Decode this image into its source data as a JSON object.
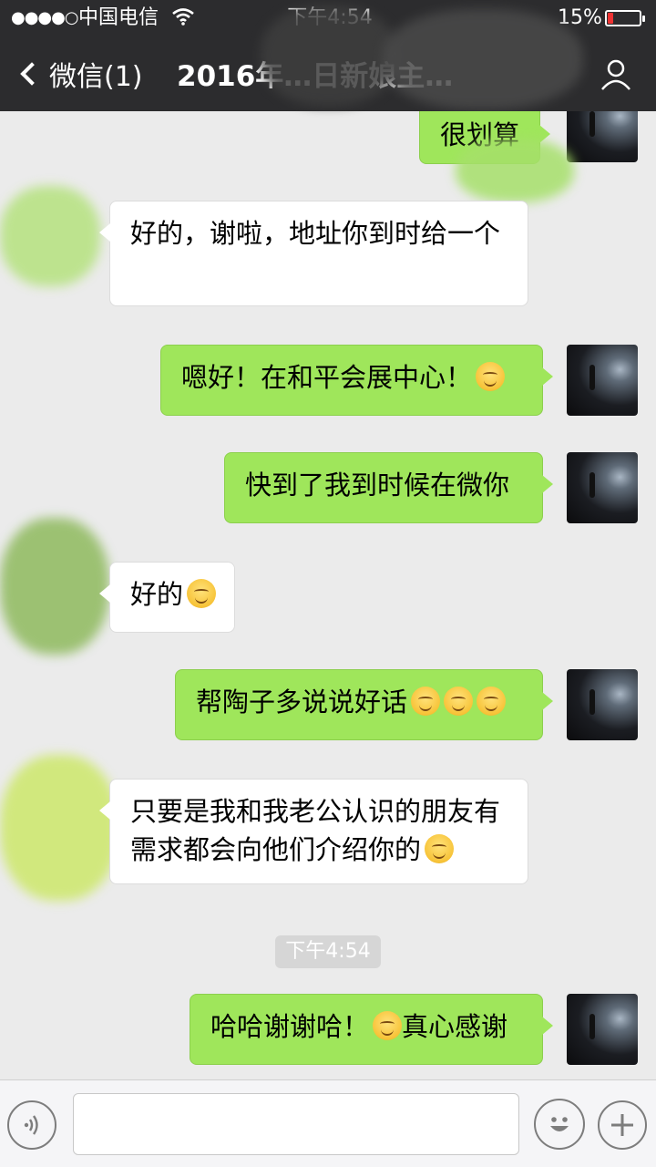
{
  "status_bar": {
    "signal": "●●●●○",
    "carrier": "中国电信",
    "time": "下午4:54",
    "battery_percent": "15%"
  },
  "nav": {
    "back_label": "微信(1)",
    "title": "2016年…日新娘主…"
  },
  "messages": [
    {
      "side": "me",
      "text": "很划算"
    },
    {
      "side": "them",
      "text": "好的，谢啦，地址你到时给一个"
    },
    {
      "side": "me",
      "text": "嗯好！在和平会展中心！",
      "emoji_count": 1
    },
    {
      "side": "me",
      "text": "快到了我到时候在微你"
    },
    {
      "side": "them",
      "text": "好的",
      "emoji_count": 1
    },
    {
      "side": "me",
      "text": "帮陶子多说说好话",
      "emoji_count": 3
    },
    {
      "side": "them",
      "text": "只要是我和我老公认识的朋友有需求都会向他们介绍你的",
      "emoji_count": 1
    },
    {
      "side": "me",
      "text_before": "哈哈谢谢哈！",
      "text_after": "真心感谢",
      "emoji_count": 1
    }
  ],
  "timestamp": "下午4:54",
  "colors": {
    "nav_bg": "#2c2c2e",
    "chat_bg": "#ebebeb",
    "my_bubble": "#9fe65b",
    "their_bubble": "#ffffff"
  },
  "icons": {
    "voice": "voice-icon",
    "emoji": "emoji-icon",
    "plus": "plus-icon",
    "chat_info": "person-icon"
  }
}
